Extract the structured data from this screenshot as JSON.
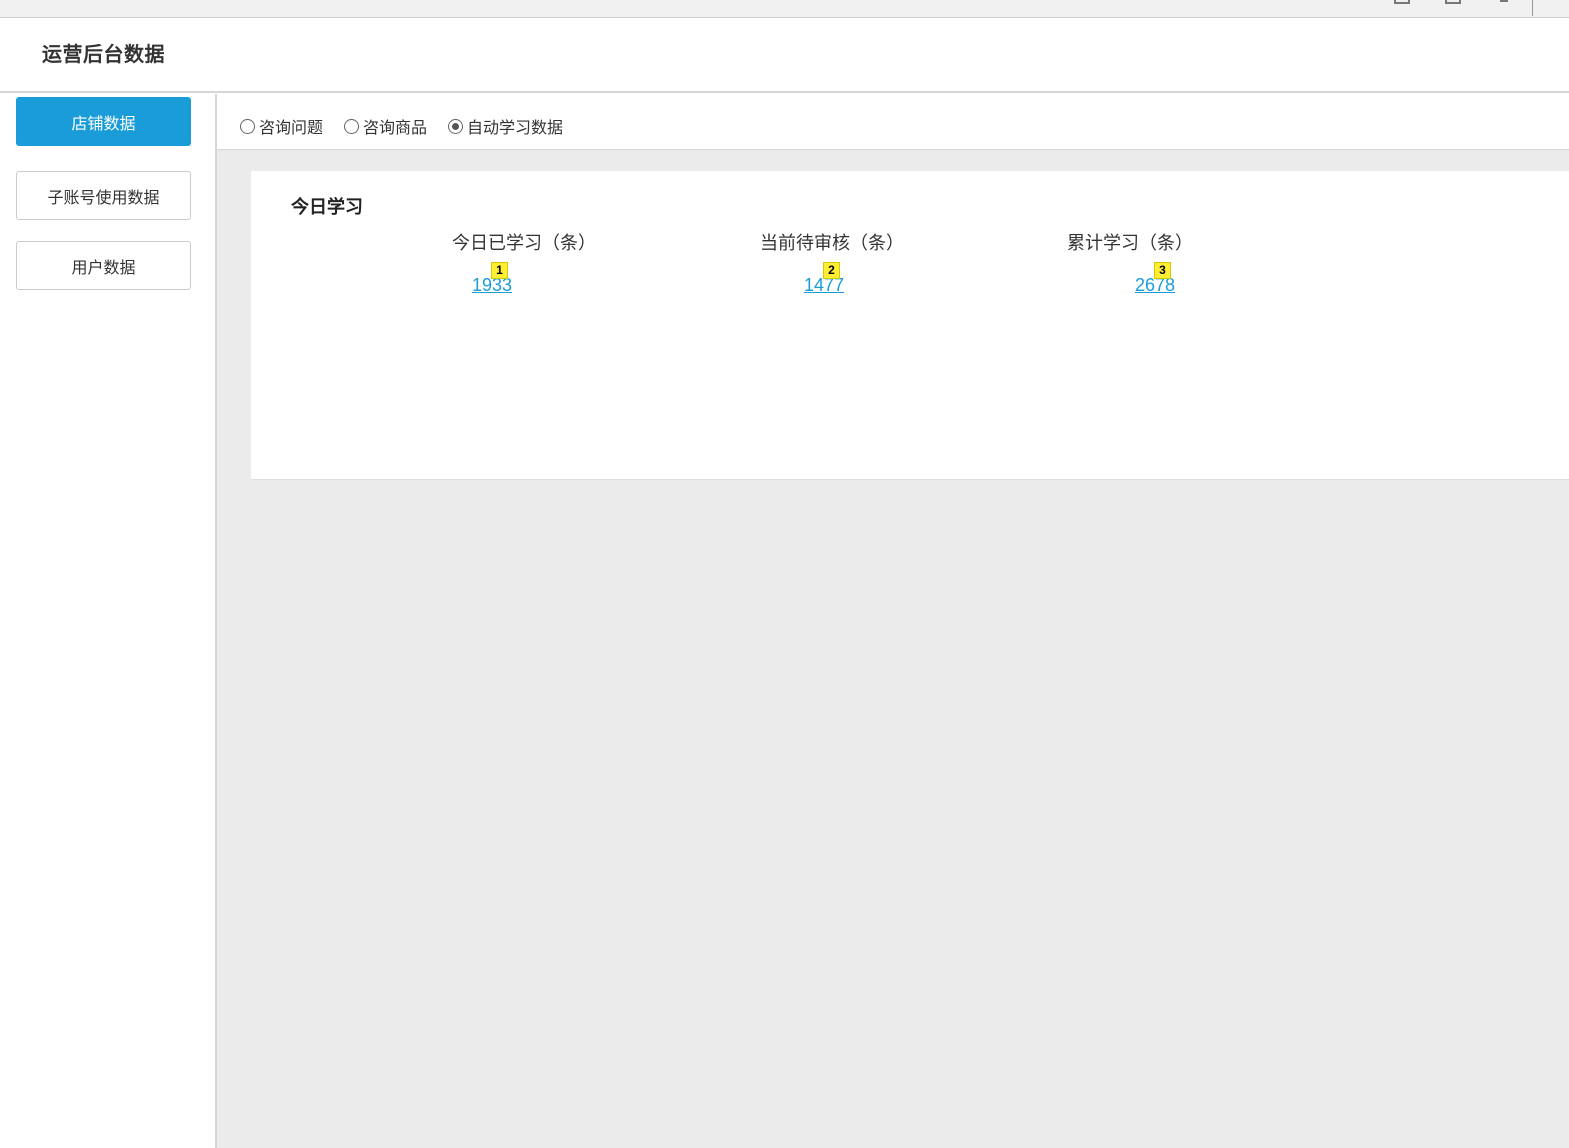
{
  "header": {
    "title": "运营后台数据"
  },
  "sidebar": {
    "items": [
      {
        "label": "店铺数据",
        "active": true
      },
      {
        "label": "子账号使用数据",
        "active": false
      },
      {
        "label": "用户数据",
        "active": false
      }
    ]
  },
  "tabs": {
    "options": [
      {
        "label": "咨询问题",
        "checked": false
      },
      {
        "label": "咨询商品",
        "checked": false
      },
      {
        "label": "自动学习数据",
        "checked": true
      }
    ]
  },
  "card": {
    "title": "今日学习",
    "stats": [
      {
        "label": "今日已学习（条）",
        "value": "1933",
        "badge": "1"
      },
      {
        "label": "当前待审核（条）",
        "value": "1477",
        "badge": "2"
      },
      {
        "label": "累计学习（条）",
        "value": "2678",
        "badge": "3"
      }
    ]
  },
  "colors": {
    "accent": "#1a9cd8",
    "badge": "#ffee33",
    "background": "#ebebeb"
  }
}
